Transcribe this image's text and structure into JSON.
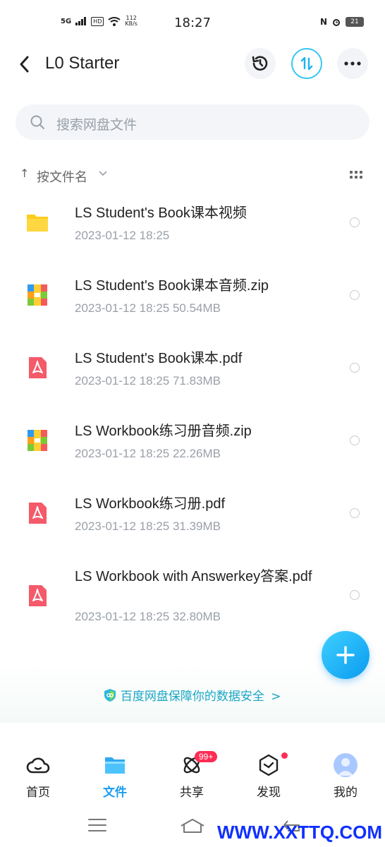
{
  "status_bar": {
    "network": "5G",
    "hd": "HD",
    "speed_value": "112",
    "speed_unit": "KB/s",
    "time": "18:27",
    "nfc": "N",
    "battery": "21"
  },
  "header": {
    "title": "L0 Starter"
  },
  "search": {
    "placeholder": "搜索网盘文件"
  },
  "sort": {
    "label": "按文件名"
  },
  "files": [
    {
      "name": "LS Student's Book课本视频",
      "meta": "2023-01-12  18:25",
      "icon": "folder-icon"
    },
    {
      "name": "LS Student's Book课本音频.zip",
      "meta": "2023-01-12  18:25   50.54MB",
      "icon": "zip-icon"
    },
    {
      "name": "LS Student's Book课本.pdf",
      "meta": "2023-01-12  18:25   71.83MB",
      "icon": "pdf-icon"
    },
    {
      "name": "LS Workbook练习册音频.zip",
      "meta": "2023-01-12  18:25   22.26MB",
      "icon": "zip-icon"
    },
    {
      "name": "LS Workbook练习册.pdf",
      "meta": "2023-01-12  18:25   31.39MB",
      "icon": "pdf-icon"
    },
    {
      "name": "LS Workbook with Answerkey答案.pdf",
      "meta": "2023-01-12  18:25   32.80MB",
      "icon": "pdf-icon"
    }
  ],
  "security": {
    "text": "百度网盘保障你的数据安全",
    "arrow": ">"
  },
  "tabs": [
    {
      "label": "首页",
      "icon": "cloud-icon"
    },
    {
      "label": "文件",
      "icon": "folder-tab-icon"
    },
    {
      "label": "共享",
      "icon": "atom-icon",
      "badge": "99+"
    },
    {
      "label": "发现",
      "icon": "cube-icon"
    },
    {
      "label": "我的",
      "icon": "avatar-icon"
    }
  ],
  "watermark": "WWW.XXTTQ.COM",
  "colors": {
    "accent": "#1a9df0",
    "badge": "#ff2d55",
    "folder": "#ffcc1a",
    "pdf": "#f45a6a"
  }
}
